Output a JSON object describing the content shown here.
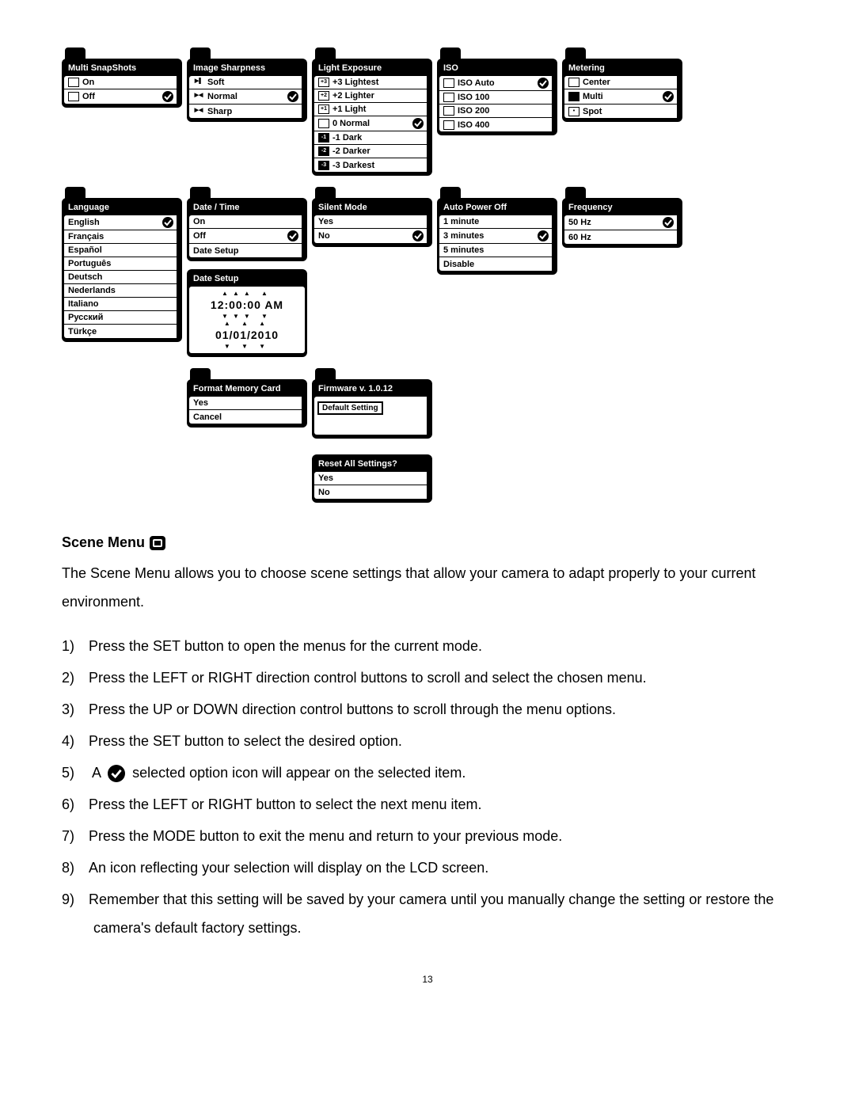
{
  "page_number": "13",
  "menus": [
    {
      "key": "multi",
      "title": "Multi SnapShots",
      "tab_icon": "stack-icon",
      "items": [
        {
          "label": "On",
          "icon": "stack-icon"
        },
        {
          "label": "Off",
          "icon": "square-icon",
          "selected": true
        }
      ]
    },
    {
      "key": "sharp",
      "title": "Image Sharpness",
      "tab_icon": "focus-icon",
      "items": [
        {
          "label": "Soft",
          "icon": "focus-icon"
        },
        {
          "label": "Normal",
          "icon": "focus-icon",
          "selected": true
        },
        {
          "label": "Sharp",
          "icon": "focus-icon"
        }
      ]
    },
    {
      "key": "expo",
      "title": "Light Exposure",
      "tab_icon": "exposure-icon",
      "items": [
        {
          "label": "+3 Lightest",
          "icon": "ev3"
        },
        {
          "label": "+2 Lighter",
          "icon": "ev2"
        },
        {
          "label": "+1 Light",
          "icon": "ev1"
        },
        {
          "label": "0 Normal",
          "icon": "ev0",
          "selected": true
        },
        {
          "label": "-1 Dark",
          "icon": "evm1"
        },
        {
          "label": "-2 Darker",
          "icon": "evm2"
        },
        {
          "label": "-3 Darkest",
          "icon": "evm3"
        }
      ]
    },
    {
      "key": "iso",
      "title": "ISO",
      "tab_icon": "iso-icon",
      "items": [
        {
          "label": "ISO Auto",
          "icon": "iso-auto",
          "selected": true
        },
        {
          "label": "ISO 100",
          "icon": "iso-100"
        },
        {
          "label": "ISO 200",
          "icon": "iso-200"
        },
        {
          "label": "ISO 400",
          "icon": "iso-400"
        }
      ]
    },
    {
      "key": "meter",
      "title": "Metering",
      "tab_icon": "meter-icon",
      "items": [
        {
          "label": "Center",
          "icon": "meter-center"
        },
        {
          "label": "Multi",
          "icon": "meter-multi",
          "selected": true
        },
        {
          "label": "Spot",
          "icon": "meter-spot"
        }
      ]
    },
    {
      "key": "lang",
      "title": "Language",
      "tab_icon": "globe-icon",
      "items": [
        {
          "label": "English",
          "selected": true
        },
        {
          "label": "Français"
        },
        {
          "label": "Español"
        },
        {
          "label": "Português"
        },
        {
          "label": "Deutsch"
        },
        {
          "label": "Nederlands"
        },
        {
          "label": "Italiano"
        },
        {
          "label": "Русский"
        },
        {
          "label": "Türkçe"
        }
      ]
    },
    {
      "key": "datetime",
      "title": "Date / Time",
      "tab_icon": "calendar-icon",
      "items": [
        {
          "label": "On"
        },
        {
          "label": "Off",
          "selected": true
        },
        {
          "label": "Date Setup"
        }
      ]
    },
    {
      "key": "silent",
      "title": "Silent Mode",
      "tab_icon": "mute-icon",
      "items": [
        {
          "label": "Yes"
        },
        {
          "label": "No",
          "selected": true
        }
      ]
    },
    {
      "key": "apo",
      "title": "Auto Power Off",
      "tab_icon": "power-icon",
      "items": [
        {
          "label": "1 minute"
        },
        {
          "label": "3 minutes",
          "selected": true
        },
        {
          "label": "5 minutes"
        },
        {
          "label": "Disable"
        }
      ]
    },
    {
      "key": "freq",
      "title": "Frequency",
      "tab_icon": "hz-icon",
      "items": [
        {
          "label": "50 Hz",
          "selected": true
        },
        {
          "label": "60 Hz"
        }
      ]
    },
    {
      "key": "datesetup",
      "title": "Date Setup",
      "tab_icon": "",
      "special": "date",
      "time": "12:00:00 AM",
      "date": "01/01/2010"
    },
    {
      "key": "format",
      "title": "Format Memory Card",
      "tab_icon": "card-icon",
      "items": [
        {
          "label": "Yes"
        },
        {
          "label": "Cancel"
        }
      ]
    },
    {
      "key": "firmware",
      "title": "Firmware v. 1.0.12",
      "tab_icon": "chip-icon",
      "special": "firmware",
      "button": "Default Setting"
    },
    {
      "key": "reset",
      "title": "Reset All Settings?",
      "tab_icon": "",
      "items": [
        {
          "label": "Yes"
        },
        {
          "label": "No"
        }
      ]
    }
  ],
  "scene_section": {
    "heading": "Scene Menu",
    "intro": "The Scene Menu allows you to choose scene settings that allow your camera to adapt properly to your current environment.",
    "steps": [
      "Press the SET button to open the menus for the current mode.",
      "Press the LEFT or RIGHT direction control buttons to scroll and select the chosen menu.",
      "Press the UP or DOWN direction control buttons to scroll through the menu options.",
      "Press the SET button to select the desired option.",
      {
        "pre": "A",
        "post": " selected option icon will appear on the selected item.",
        "with_check": true
      },
      "Press the LEFT or RIGHT button to select the next menu item.",
      "Press the MODE button to exit the menu and return to your previous mode.",
      "An icon reflecting your selection will display on the LCD screen.",
      "Remember that this setting will be saved by your camera until you manually change the setting or restore the camera's default factory settings."
    ]
  }
}
